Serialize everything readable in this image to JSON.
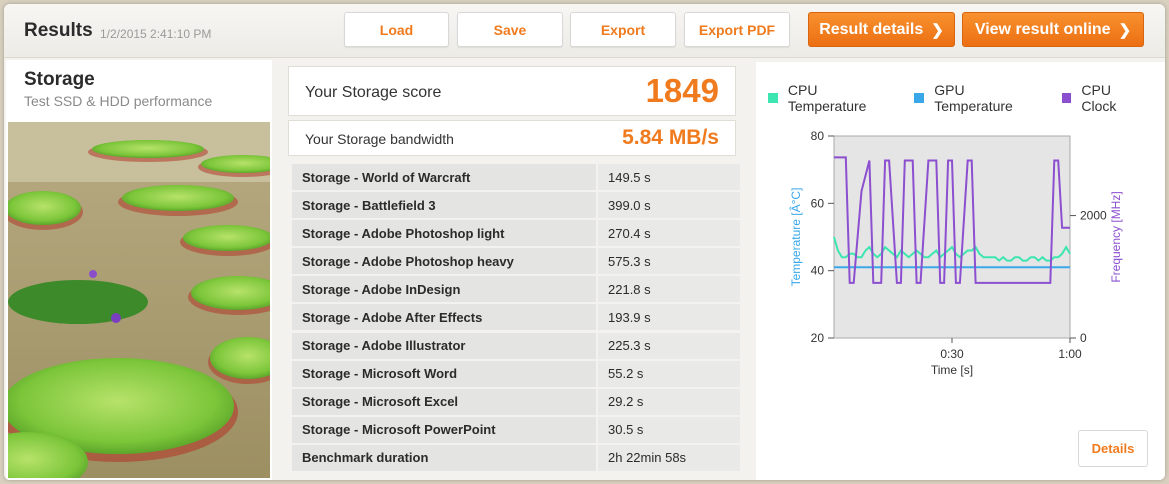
{
  "header": {
    "title": "Results",
    "timestamp": "1/2/2015 2:41:10 PM",
    "buttons": {
      "load": "Load",
      "save": "Save",
      "export": "Export",
      "export_pdf": "Export PDF",
      "result_details": "Result details",
      "view_online": "View result online"
    }
  },
  "left": {
    "heading": "Storage",
    "subheading": "Test SSD & HDD performance"
  },
  "score": {
    "label": "Your Storage score",
    "value": "1849",
    "bandwidth_label": "Your Storage bandwidth",
    "bandwidth_value": "5.84 MB/s"
  },
  "results": [
    {
      "name": "Storage - World of Warcraft",
      "value": "149.5 s"
    },
    {
      "name": "Storage - Battlefield 3",
      "value": "399.0 s"
    },
    {
      "name": "Storage - Adobe Photoshop light",
      "value": "270.4 s"
    },
    {
      "name": "Storage - Adobe Photoshop heavy",
      "value": "575.3 s"
    },
    {
      "name": "Storage - Adobe InDesign",
      "value": "221.8 s"
    },
    {
      "name": "Storage - Adobe After Effects",
      "value": "193.9 s"
    },
    {
      "name": "Storage - Adobe Illustrator",
      "value": "225.3 s"
    },
    {
      "name": "Storage - Microsoft Word",
      "value": "55.2 s"
    },
    {
      "name": "Storage - Microsoft Excel",
      "value": "29.2 s"
    },
    {
      "name": "Storage - Microsoft PowerPoint",
      "value": "30.5 s"
    },
    {
      "name": "Benchmark duration",
      "value": "2h 22min 58s"
    }
  ],
  "details_button": "Details",
  "colors": {
    "accent": "#f07b1e",
    "cpu_temp": "#3de6b0",
    "gpu_temp": "#3aa8e8",
    "cpu_clock": "#8b4fd0"
  },
  "chart_data": {
    "type": "line",
    "xlabel": "Time [s]",
    "ylabel_left": "Temperature [Â°C]",
    "ylabel_right": "Frequency [MHz]",
    "x_ticks": [
      "0:30",
      "1:00"
    ],
    "x_tick_values": [
      30,
      60
    ],
    "xlim": [
      0,
      60
    ],
    "y_left_ticks": [
      20,
      40,
      60,
      80
    ],
    "ylim_left": [
      20,
      80
    ],
    "y_right_ticks": [
      0,
      2000
    ],
    "ylim_right": [
      0,
      3300
    ],
    "legend": "top",
    "grid": false,
    "series": [
      {
        "name": "CPU Temperature",
        "axis": "left",
        "x": [
          0,
          1,
          2,
          3,
          4,
          5,
          6,
          7,
          8,
          9,
          10,
          11,
          12,
          13,
          14,
          15,
          16,
          17,
          18,
          19,
          20,
          21,
          22,
          23,
          24,
          25,
          26,
          27,
          28,
          29,
          30,
          31,
          32,
          33,
          34,
          35,
          36,
          37,
          38,
          39,
          40,
          41,
          42,
          43,
          44,
          45,
          46,
          47,
          48,
          49,
          50,
          51,
          52,
          53,
          54,
          55,
          56,
          57,
          58,
          59,
          60
        ],
        "values": [
          50,
          46,
          44,
          44,
          45,
          45,
          44,
          44,
          46,
          47,
          45,
          44,
          45,
          47,
          46,
          45,
          44,
          46,
          45,
          44,
          45,
          46,
          45,
          44,
          44,
          45,
          46,
          44,
          45,
          46,
          47,
          45,
          44,
          45,
          46,
          46,
          47,
          45,
          44,
          44,
          44,
          44,
          43,
          44,
          43,
          43,
          44,
          44,
          43,
          43,
          44,
          44,
          43,
          44,
          43,
          43,
          44,
          44,
          45,
          47,
          45
        ]
      },
      {
        "name": "GPU Temperature",
        "axis": "left",
        "x": [
          0,
          60
        ],
        "values": [
          41,
          41
        ]
      },
      {
        "name": "CPU Clock",
        "axis": "right",
        "x": [
          0,
          3,
          4,
          5,
          7,
          9,
          10,
          12,
          13,
          14,
          16,
          17,
          18,
          20,
          21,
          22,
          24,
          26,
          27,
          28,
          29,
          30,
          31,
          32,
          34,
          35,
          36,
          37,
          38,
          40,
          44,
          48,
          49,
          50,
          52,
          54,
          55,
          56,
          57,
          58,
          59,
          60
        ],
        "values": [
          2950,
          2950,
          900,
          900,
          2400,
          2900,
          900,
          900,
          2900,
          2900,
          900,
          900,
          2900,
          2900,
          900,
          900,
          2900,
          2900,
          900,
          900,
          2900,
          2900,
          900,
          900,
          2900,
          2900,
          900,
          900,
          900,
          900,
          900,
          900,
          900,
          900,
          900,
          900,
          900,
          2900,
          2900,
          1800,
          1800,
          1800
        ]
      }
    ]
  }
}
